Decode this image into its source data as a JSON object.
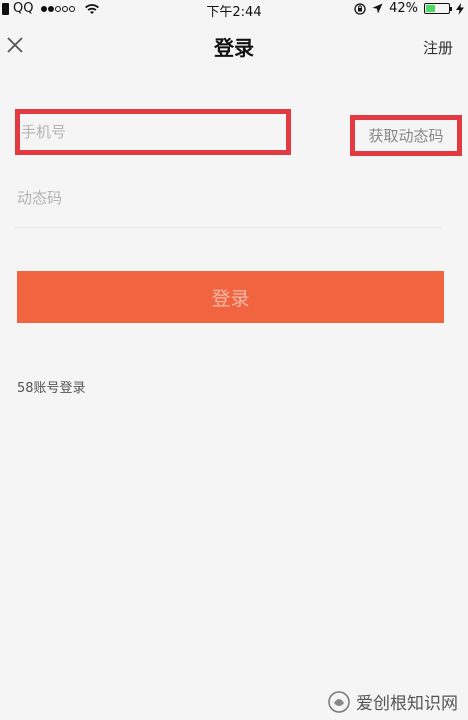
{
  "status_bar": {
    "carrier": "QQ",
    "time": "下午2:44",
    "battery_percent": "42%",
    "battery_level": 0.42,
    "signal_bars_full": 2,
    "signal_bars_total": 5,
    "battery_fill_color": "#4cd964"
  },
  "nav": {
    "title": "登录",
    "register_label": "注册",
    "close_icon": "close-icon"
  },
  "form": {
    "phone_placeholder": "手机号",
    "phone_value": "",
    "get_code_label": "获取动态码",
    "code_placeholder": "动态码",
    "code_value": "",
    "highlight_color": "#e23a40"
  },
  "login": {
    "button_label": "登录",
    "button_color": "#f0643f",
    "alt_login_label": "58账号登录"
  },
  "watermark": {
    "text": "爱创根知识网"
  }
}
